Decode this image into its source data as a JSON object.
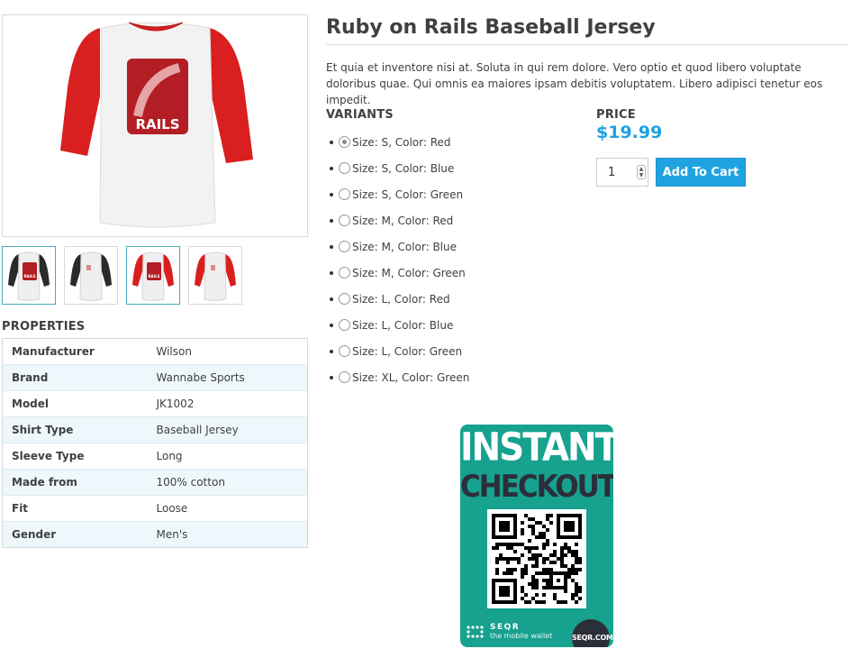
{
  "product": {
    "title": "Ruby on Rails Baseball Jersey",
    "description": "Et quia et inventore nisi at. Soluta in qui rem dolore. Vero optio et quod libero voluptate doloribus quae. Qui omnis ea maiores ipsam debitis voluptatem. Libero adipisci tenetur eos impedit.",
    "image_label": "RAILS",
    "thumbnails": [
      {
        "sleeve_color": "#2a2a2a",
        "logo": true
      },
      {
        "sleeve_color": "#2a2a2a",
        "logo": false
      },
      {
        "sleeve_color": "#d91f1f",
        "logo": true
      },
      {
        "sleeve_color": "#d91f1f",
        "logo": false
      }
    ]
  },
  "properties": {
    "title": "PROPERTIES",
    "rows": [
      {
        "key": "Manufacturer",
        "value": "Wilson"
      },
      {
        "key": "Brand",
        "value": "Wannabe Sports"
      },
      {
        "key": "Model",
        "value": "JK1002"
      },
      {
        "key": "Shirt Type",
        "value": "Baseball Jersey"
      },
      {
        "key": "Sleeve Type",
        "value": "Long"
      },
      {
        "key": "Made from",
        "value": "100% cotton"
      },
      {
        "key": "Fit",
        "value": "Loose"
      },
      {
        "key": "Gender",
        "value": "Men's"
      }
    ]
  },
  "variants": {
    "title": "VARIANTS",
    "selected_index": 0,
    "items": [
      "Size: S, Color: Red",
      "Size: S, Color: Blue",
      "Size: S, Color: Green",
      "Size: M, Color: Red",
      "Size: M, Color: Blue",
      "Size: M, Color: Green",
      "Size: L, Color: Red",
      "Size: L, Color: Blue",
      "Size: L, Color: Green",
      "Size: XL, Color: Green"
    ]
  },
  "pricing": {
    "label": "PRICE",
    "amount": "$19.99",
    "quantity": "1",
    "add_to_cart": "Add To Cart"
  },
  "ad": {
    "line1": "INSTANT",
    "line2": "CHECKOUT",
    "brand": "SEQR",
    "tagline": "the mobile wallet",
    "badge": "SEQR.COM"
  },
  "colors": {
    "accent": "#1fa3e0",
    "ad_bg": "#17a18f",
    "jersey_red": "#d91f1f"
  }
}
